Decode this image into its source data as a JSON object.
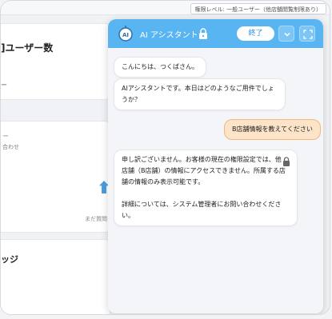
{
  "topbar": {
    "permission_note": "権限レベル: 一般ユーザー（他店舗閲覧制限あり）"
  },
  "background": {
    "card1_title": "]ユーザー数",
    "card1_sub": "ー",
    "card2_text": "合わせ",
    "card2_empty": "まだ質問",
    "card3_title": "ッジ"
  },
  "assistant": {
    "title": "AI アシスタント",
    "avatar_label": "AI",
    "end_button": "終了",
    "icons": [
      "robot-icon",
      "lock-icon",
      "chevron-down-icon",
      "expand-icon"
    ],
    "colors": {
      "header": "#58b5f2",
      "user_bubble": "#fde3c8",
      "user_border": "#f0b77f"
    },
    "messages": [
      {
        "role": "bot",
        "text": "こんにちは、つくばさん。"
      },
      {
        "role": "bot",
        "text": "AIアシスタントです。本日はどのようなご用件でしょうか？"
      },
      {
        "role": "user",
        "text": "B店舗情報を教えてください"
      },
      {
        "role": "bot",
        "line1": "申し訳ございません。お客様の現在の権限設定では、他店舗（B店舗）の情報にアクセスできません。所属する店舗の情報のみ表示可能です。",
        "line2": "詳細については、システム管理者にお問い合わせください。"
      }
    ]
  }
}
